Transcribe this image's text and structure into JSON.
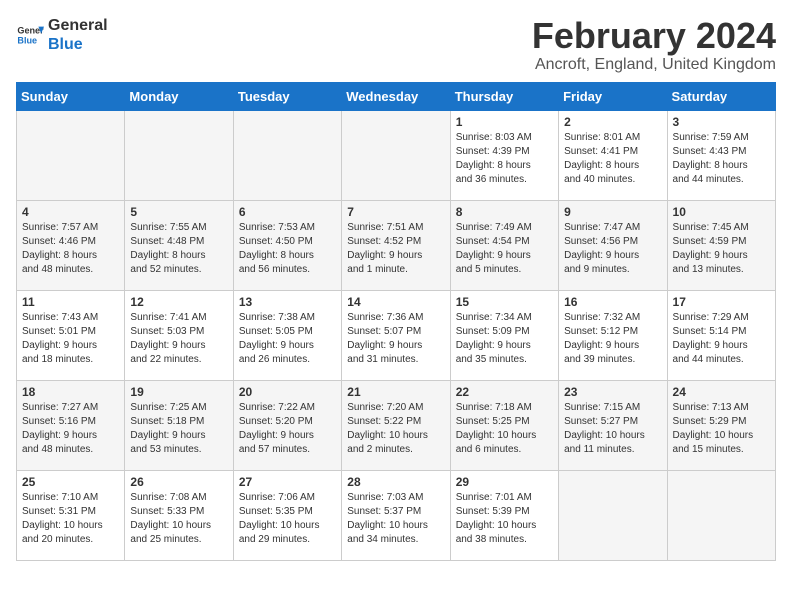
{
  "logo": {
    "line1": "General",
    "line2": "Blue"
  },
  "title": "February 2024",
  "subtitle": "Ancroft, England, United Kingdom",
  "header_accent": "#1a73c8",
  "days_of_week": [
    "Sunday",
    "Monday",
    "Tuesday",
    "Wednesday",
    "Thursday",
    "Friday",
    "Saturday"
  ],
  "weeks": [
    [
      {
        "day": "",
        "info": ""
      },
      {
        "day": "",
        "info": ""
      },
      {
        "day": "",
        "info": ""
      },
      {
        "day": "",
        "info": ""
      },
      {
        "day": "1",
        "info": "Sunrise: 8:03 AM\nSunset: 4:39 PM\nDaylight: 8 hours\nand 36 minutes."
      },
      {
        "day": "2",
        "info": "Sunrise: 8:01 AM\nSunset: 4:41 PM\nDaylight: 8 hours\nand 40 minutes."
      },
      {
        "day": "3",
        "info": "Sunrise: 7:59 AM\nSunset: 4:43 PM\nDaylight: 8 hours\nand 44 minutes."
      }
    ],
    [
      {
        "day": "4",
        "info": "Sunrise: 7:57 AM\nSunset: 4:46 PM\nDaylight: 8 hours\nand 48 minutes."
      },
      {
        "day": "5",
        "info": "Sunrise: 7:55 AM\nSunset: 4:48 PM\nDaylight: 8 hours\nand 52 minutes."
      },
      {
        "day": "6",
        "info": "Sunrise: 7:53 AM\nSunset: 4:50 PM\nDaylight: 8 hours\nand 56 minutes."
      },
      {
        "day": "7",
        "info": "Sunrise: 7:51 AM\nSunset: 4:52 PM\nDaylight: 9 hours\nand 1 minute."
      },
      {
        "day": "8",
        "info": "Sunrise: 7:49 AM\nSunset: 4:54 PM\nDaylight: 9 hours\nand 5 minutes."
      },
      {
        "day": "9",
        "info": "Sunrise: 7:47 AM\nSunset: 4:56 PM\nDaylight: 9 hours\nand 9 minutes."
      },
      {
        "day": "10",
        "info": "Sunrise: 7:45 AM\nSunset: 4:59 PM\nDaylight: 9 hours\nand 13 minutes."
      }
    ],
    [
      {
        "day": "11",
        "info": "Sunrise: 7:43 AM\nSunset: 5:01 PM\nDaylight: 9 hours\nand 18 minutes."
      },
      {
        "day": "12",
        "info": "Sunrise: 7:41 AM\nSunset: 5:03 PM\nDaylight: 9 hours\nand 22 minutes."
      },
      {
        "day": "13",
        "info": "Sunrise: 7:38 AM\nSunset: 5:05 PM\nDaylight: 9 hours\nand 26 minutes."
      },
      {
        "day": "14",
        "info": "Sunrise: 7:36 AM\nSunset: 5:07 PM\nDaylight: 9 hours\nand 31 minutes."
      },
      {
        "day": "15",
        "info": "Sunrise: 7:34 AM\nSunset: 5:09 PM\nDaylight: 9 hours\nand 35 minutes."
      },
      {
        "day": "16",
        "info": "Sunrise: 7:32 AM\nSunset: 5:12 PM\nDaylight: 9 hours\nand 39 minutes."
      },
      {
        "day": "17",
        "info": "Sunrise: 7:29 AM\nSunset: 5:14 PM\nDaylight: 9 hours\nand 44 minutes."
      }
    ],
    [
      {
        "day": "18",
        "info": "Sunrise: 7:27 AM\nSunset: 5:16 PM\nDaylight: 9 hours\nand 48 minutes."
      },
      {
        "day": "19",
        "info": "Sunrise: 7:25 AM\nSunset: 5:18 PM\nDaylight: 9 hours\nand 53 minutes."
      },
      {
        "day": "20",
        "info": "Sunrise: 7:22 AM\nSunset: 5:20 PM\nDaylight: 9 hours\nand 57 minutes."
      },
      {
        "day": "21",
        "info": "Sunrise: 7:20 AM\nSunset: 5:22 PM\nDaylight: 10 hours\nand 2 minutes."
      },
      {
        "day": "22",
        "info": "Sunrise: 7:18 AM\nSunset: 5:25 PM\nDaylight: 10 hours\nand 6 minutes."
      },
      {
        "day": "23",
        "info": "Sunrise: 7:15 AM\nSunset: 5:27 PM\nDaylight: 10 hours\nand 11 minutes."
      },
      {
        "day": "24",
        "info": "Sunrise: 7:13 AM\nSunset: 5:29 PM\nDaylight: 10 hours\nand 15 minutes."
      }
    ],
    [
      {
        "day": "25",
        "info": "Sunrise: 7:10 AM\nSunset: 5:31 PM\nDaylight: 10 hours\nand 20 minutes."
      },
      {
        "day": "26",
        "info": "Sunrise: 7:08 AM\nSunset: 5:33 PM\nDaylight: 10 hours\nand 25 minutes."
      },
      {
        "day": "27",
        "info": "Sunrise: 7:06 AM\nSunset: 5:35 PM\nDaylight: 10 hours\nand 29 minutes."
      },
      {
        "day": "28",
        "info": "Sunrise: 7:03 AM\nSunset: 5:37 PM\nDaylight: 10 hours\nand 34 minutes."
      },
      {
        "day": "29",
        "info": "Sunrise: 7:01 AM\nSunset: 5:39 PM\nDaylight: 10 hours\nand 38 minutes."
      },
      {
        "day": "",
        "info": ""
      },
      {
        "day": "",
        "info": ""
      }
    ]
  ]
}
